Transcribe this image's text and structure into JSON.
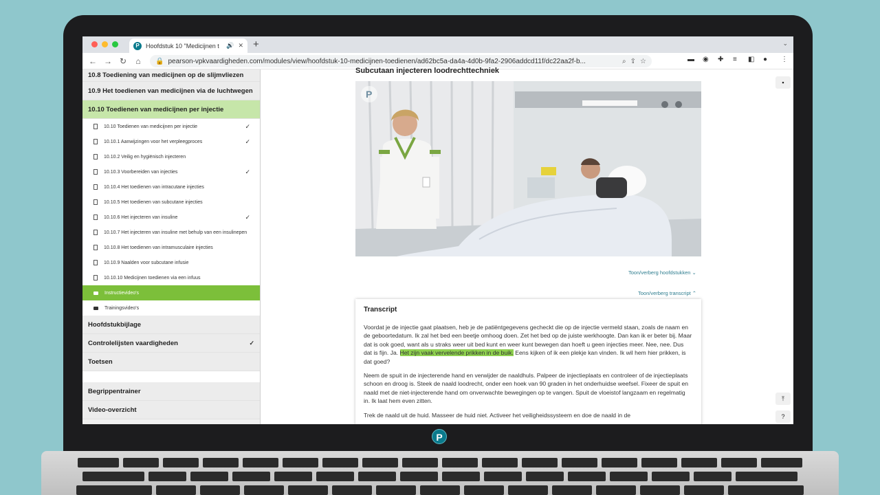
{
  "browser": {
    "tab_title": "Hoofdstuk 10 \"Medicijnen t",
    "url": "pearson-vpkvaardigheden.com/modules/view/hoofdstuk-10-medicijnen-toedienen/ad62bc5a-da4a-4d0b-9fa2-2906addcd11f/dc22aa2f-b..."
  },
  "sidebar": {
    "top_sections": [
      "10.8 Toediening van medicijnen op de slijmvliezen",
      "10.9 Het toedienen van medicijnen via de luchtwegen",
      "10.10 Toedienen van medicijnen per injectie"
    ],
    "items": [
      {
        "label": "10.10 Toedienen van medicijnen per injectie",
        "checked": "✓"
      },
      {
        "label": "10.10.1 Aanwijzingen voor het verpleegproces",
        "checked": "✓"
      },
      {
        "label": "10.10.2 Veilig en hygiënisch injecteren",
        "checked": ""
      },
      {
        "label": "10.10.3 Voorbereiden van injecties",
        "checked": "✓"
      },
      {
        "label": "10.10.4 Het toedienen van intracutane injecties",
        "checked": ""
      },
      {
        "label": "10.10.5 Het toedienen van subcutane injecties",
        "checked": ""
      },
      {
        "label": "10.10.6 Het injecteren van insuline",
        "checked": "✓"
      },
      {
        "label": "10.10.7 Het injecteren van insuline met behulp van een insulinepen",
        "checked": ""
      },
      {
        "label": "10.10.8 Het toedienen van intramusculaire injecties",
        "checked": ""
      },
      {
        "label": "10.10.9 Naalden voor subcutane infusie",
        "checked": ""
      },
      {
        "label": "10.10.10 Medicijnen toedienen via een infuus",
        "checked": ""
      },
      {
        "label": "Instructievideo's",
        "checked": ""
      },
      {
        "label": "Trainingsvideo's",
        "checked": ""
      }
    ],
    "bottom_sections": [
      {
        "label": "Hoofdstukbijlage",
        "checked": ""
      },
      {
        "label": "Controlelijsten vaardigheden",
        "checked": "✓"
      },
      {
        "label": "Toetsen",
        "checked": ""
      }
    ],
    "extra_sections": [
      "Begrippentrainer",
      "Video-overzicht"
    ]
  },
  "main": {
    "video_title": "Subcutaan injecteren loodrechttechniek",
    "toggle_chapters": "Toon/verberg hoofdstukken ⌄",
    "toggle_transcript": "Toon/verberg transcript ⌃",
    "transcript": {
      "title": "Transcript",
      "p1_before": "Voordat je de injectie gaat plaatsen, heb je de patiëntgegevens gecheckt die op de injectie vermeld staan, zoals de naam en de geboortedatum. Ik zal het bed een beetje omhoog doen. Zet het bed op de juiste werkhoogte. Dan kan ik er beter bij. Maar dat is ook goed, want als u straks weer uit bed kunt en weer kunt bewegen dan hoeft u geen injecties meer. Nee, nee. Dus dat is fijn. Ja. ",
      "p1_highlight": "Het zijn vaak vervelende prikken in de buik.",
      "p1_after": " Eens kijken of ik een plekje kan vinden. Ik wil hem hier prikken, is dat goed?",
      "p2": "Neem de spuit in de injecterende hand en verwijder de naaldhuls. Palpeer de injectieplaats en controleer of de injectieplaats schoon en droog is. Steek de naald loodrecht, onder een hoek van 90 graden in het onderhuidse weefsel. Fixeer de spuit en naald met de niet-injecterende hand om onverwachte bewegingen op te vangen. Spuit de vloeistof langzaam en regelmatig in. Ik laat hem even zitten.",
      "p3": "Trek de naald uit de huid. Masseer de huid niet. Activeer het veiligheidssysteem en doe de naald in de"
    }
  },
  "colors": {
    "accent_green": "#7cbf3a",
    "active_section": "#c6e6a9",
    "highlight": "#8fd14f",
    "link": "#2e7d8f",
    "brand_teal": "#0a7a8c"
  }
}
